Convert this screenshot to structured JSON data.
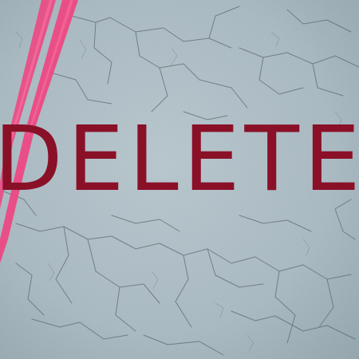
{
  "image": {
    "text": "DELETE",
    "colors": {
      "wall": "#aebec6",
      "crack": "#5e6a72",
      "stripe": "#f0427f",
      "text": "#8a1028"
    }
  }
}
